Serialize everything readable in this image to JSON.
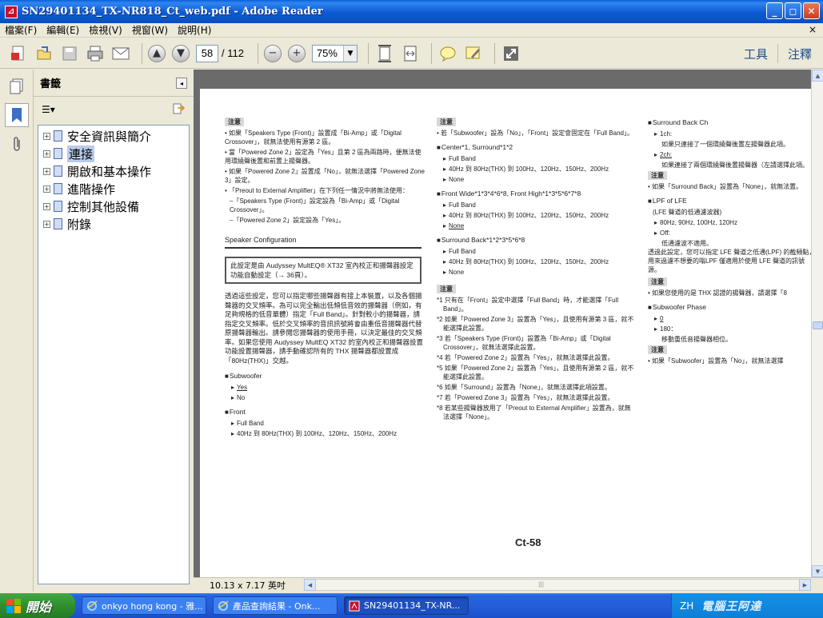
{
  "window": {
    "title": "SN29401134_TX-NR818_Ct_web.pdf - Adobe Reader",
    "app_icon": "pdf-icon",
    "controls": {
      "minimize": "_",
      "maximize": "◻",
      "close": "✕"
    }
  },
  "menu": {
    "items": [
      "檔案(F)",
      "編輯(E)",
      "檢視(V)",
      "視窗(W)",
      "說明(H)"
    ],
    "close": "×"
  },
  "toolbar": {
    "current_page": "58",
    "total_pages": "/ 112",
    "zoom": "75%",
    "tools_label": "工具",
    "comment_label": "注釋",
    "icons": [
      "create-pdf-icon",
      "open-icon",
      "save-icon",
      "print-icon",
      "email-icon",
      "page-up-icon",
      "page-down-icon",
      "zoom-out-icon",
      "zoom-in-icon",
      "fit-page-icon",
      "fit-width-icon",
      "sticky-note-icon",
      "highlight-icon",
      "fullscreen-icon"
    ]
  },
  "sidebar": {
    "header": "書籤",
    "options_label": "☰▾",
    "items": [
      {
        "label": "安全資訊與簡介",
        "selected": false
      },
      {
        "label": "連接",
        "selected": true
      },
      {
        "label": "開啟和基本操作",
        "selected": false
      },
      {
        "label": "進階操作",
        "selected": false
      },
      {
        "label": "控制其他設備",
        "selected": false
      },
      {
        "label": "附錄",
        "selected": false
      }
    ]
  },
  "document": {
    "col1": {
      "note_tag": "注意",
      "notes": [
        "• 如果「Speakers Type (Front)」設置成「Bi-Amp」或「Digital Crossover」，就無法使用有源第 2 區。",
        "• 當「Powered Zone 2」設定為「Yes」且第 2 區為兩路時，便無法使用環繞聲後置和前置上揚聲器。",
        "• 如果「Powered Zone 2」設置成「No」，就無法選擇「Powered Zone 3」設定。",
        "• 「Preout to External Amplifier」在下列任一情況中將無法使用：",
        "–「Speakers Type (Front)」設定設為「Bi-Amp」或「Digital Crossover」。",
        "–「Powered Zone 2」設定設為「Yes」。"
      ],
      "section_title": "Speaker Configuration",
      "boxed": "此設定是由 Audyssey MultEQ® XT32 室內校正和揚聲器設定功能自動設定（→ 36頁）。",
      "paragraph": "透過這些設定，您可以指定哪些揚聲器有接上本裝置，以及各個揚聲器的交叉頻率。為可以完全輸出低頻低音效的揚聲器（例如，有足夠規格的低音單體）指定「Full Band」。針對較小的揚聲器，請指定交叉頻率。低於交叉頻率的音訊訊號將會由重低音揚聲器代替原揚聲器輸出。請參閱您揚聲器的使用手冊，以決定最佳的交叉頻率。如果您使用 Audyssey MultEQ XT32 的室內校正和揚聲器設置功能設置揚聲器，請手動確認所有的 THX 揚聲器都設置成「80Hz(THX)」交越。",
      "subwoofer": {
        "head": "Subwoofer",
        "options": [
          "Yes",
          "No"
        ]
      },
      "front": {
        "head": "Front",
        "options": [
          "Full Band",
          "40Hz 到 80Hz(THX) 到 100Hz、120Hz、150Hz、200Hz"
        ]
      }
    },
    "col2": {
      "note_tag": "注意",
      "note": "• 若「Subwoofer」設為「No」，「Front」設定會固定在「Full Band」。",
      "center": {
        "head": "Center*1, Surround*1*2",
        "options": [
          "Full Band",
          "40Hz 到 80Hz(THX) 到 100Hz、120Hz、150Hz、200Hz",
          "None"
        ]
      },
      "front_wide": {
        "head": "Front Wide*1*3*4*6*8, Front High*1*3*5*6*7*8",
        "options": [
          "Full Band",
          "40Hz 到 80Hz(THX) 到 100Hz、120Hz、150Hz、200Hz",
          "None"
        ]
      },
      "surround_back": {
        "head": "Surround Back*1*2*3*5*6*8",
        "options": [
          "Full Band",
          "40Hz 到 80Hz(THX) 到 100Hz、120Hz、150Hz、200Hz",
          "None"
        ]
      },
      "fn_tag": "注意",
      "footnotes": [
        "*1 只有在「Front」設定中選擇「Full Band」時，才能選擇「Full Band」。",
        "*2 如果「Powered Zone 3」設置為「Yes」，且使用有源第 3 區，就不能選擇此設置。",
        "*3 若「Speakers Type (Front)」設置為「Bi-Amp」或「Digital Crossover」，就無法選擇此設置。",
        "*4 若「Powered Zone 2」設置為「Yes」，就無法選擇此設置。",
        "*5 如果「Powered Zone 2」設置為「Yes」，且使用有源第 2 區，就不能選擇此設置。",
        "*6 如果「Surround」設置為「None」，就無法選擇此項設置。",
        "*7 若「Powered Zone 3」設置為「Yes」，就無法選擇此設置。",
        "*8 若某些揚聲器放用了「Preout to External Amplifier」設置為，就無法選擇「None」。"
      ]
    },
    "col3": {
      "surround_back_ch": {
        "head": "Surround Back Ch",
        "opt1": "1ch:",
        "opt1_desc": "如果只連接了一個環繞聲後置左揚聲器此項。",
        "opt2": "2ch:",
        "opt2_desc": "如果連接了兩個環繞聲後置揚聲器（左請選擇此項。"
      },
      "note_tag": "注意",
      "note": "• 如果「Surround Back」設置為「None」，就無法置。",
      "lpf": {
        "head": "LPF of LFE",
        "sub": "(LFE 聲道的低通濾波器)",
        "opt1": "80Hz, 90Hz, 100Hz, 120Hz",
        "opt2": "Off:",
        "opt2_desc": "低通濾波不適用。",
        "desc": "透過此設定，您可以指定 LFE 聲道之低通(LPF) 的截頻點，用來過濾不想要的嗡LPF 僅適用於使用 LFE 聲道的訊號源。"
      },
      "note2_tag": "注意",
      "note2": "• 如果您使用的是 THX 認證的揚聲器，請選擇「8",
      "phase": {
        "head": "Subwoofer Phase",
        "opt1": "0",
        "opt2": "180：",
        "opt2_desc": "移動重低音揚聲器相位。"
      },
      "note3_tag": "注意",
      "note3": "• 如果「Subwoofer」設置為「No」，就無法選擇"
    },
    "page_number": "Ct-58"
  },
  "status": {
    "page_size": "10.13 x 7.17 英吋"
  },
  "taskbar": {
    "start_label": "開始",
    "tasks": [
      {
        "label": "onkyo hong kong - 雅...",
        "icon": "ie-icon",
        "active": false
      },
      {
        "label": "產品查詢結果 - Onk...",
        "icon": "ie-icon",
        "active": false
      },
      {
        "label": "SN29401134_TX-NR...",
        "icon": "pdf-icon",
        "active": true
      }
    ],
    "tray_lang": "ZH",
    "tray_watermark": "電腦王阿達"
  },
  "colors": {
    "title_bar": "#0c5ad2",
    "selection": "#b9cbeb",
    "doc_background": "#6b6b6b",
    "taskbar": "#245edb",
    "start": "#2f8f2f"
  }
}
